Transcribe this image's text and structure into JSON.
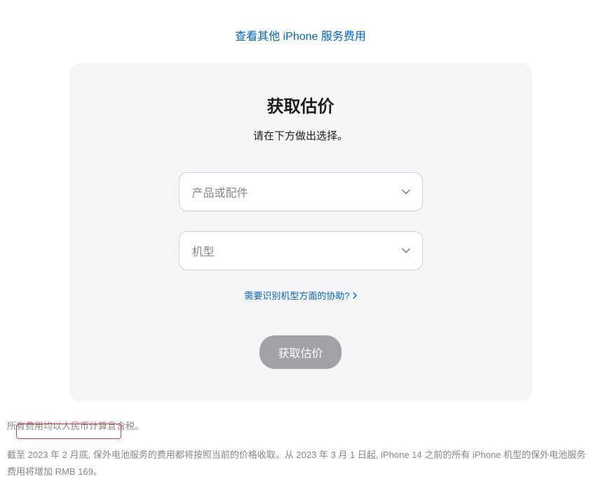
{
  "topLink": {
    "label": "查看其他 iPhone 服务费用"
  },
  "card": {
    "title": "获取估价",
    "subtitle": "请在下方做出选择。",
    "select1": {
      "placeholder": "产品或配件"
    },
    "select2": {
      "placeholder": "机型"
    },
    "helpLink": {
      "label": "需要识别机型方面的协助?"
    },
    "submit": {
      "label": "获取估价"
    }
  },
  "notes": {
    "line1": "所有费用均以人民币计算且含税。",
    "line2": "截至 2023 年 2 月底, 保外电池服务的费用都将按照当前的价格收取。从 2023 年 3 月 1 日起, iPhone 14 之前的所有 iPhone 机型的保外电池服务费用将增加 RMB 169。"
  }
}
